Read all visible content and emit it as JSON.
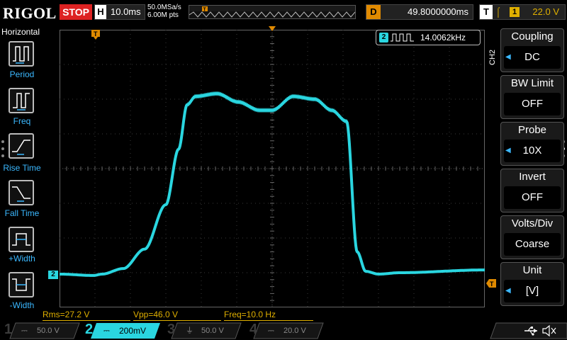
{
  "header": {
    "brand": "RIGOL",
    "run_state": "STOP",
    "timebase_label": "H",
    "timebase_value": "10.0ms",
    "sample_rate": "50.0MSa/s",
    "memory_depth": "6.00M pts",
    "trigger_position_label": "D",
    "trigger_position_value": "49.8000000ms",
    "trigger_type_label": "T",
    "trigger_source": "1",
    "trigger_level": "22.0 V"
  },
  "left_menu": {
    "title": "Horizontal",
    "items": [
      {
        "label": "Period",
        "icon": "period-icon"
      },
      {
        "label": "Freq",
        "icon": "freq-icon"
      },
      {
        "label": "Rise Time",
        "icon": "rise-time-icon"
      },
      {
        "label": "Fall Time",
        "icon": "fall-time-icon"
      },
      {
        "label": "+Width",
        "icon": "pos-width-icon"
      },
      {
        "label": "-Width",
        "icon": "neg-width-icon"
      }
    ]
  },
  "freq_counter": {
    "channel": "2",
    "value": "14.0062kHz"
  },
  "right_menu": {
    "channel_tag": "CH2",
    "items": [
      {
        "title": "Coupling",
        "value": "DC"
      },
      {
        "title": "BW Limit",
        "value": "OFF"
      },
      {
        "title": "Probe",
        "value": "10X"
      },
      {
        "title": "Invert",
        "value": "OFF"
      },
      {
        "title": "Volts/Div",
        "value": "Coarse"
      },
      {
        "title": "Unit",
        "value": "[V]"
      }
    ]
  },
  "measurements": [
    {
      "text": "Rms=27.2 V"
    },
    {
      "text": "Vpp=46.0 V"
    },
    {
      "text": "Freq=10.0 Hz"
    }
  ],
  "channels": [
    {
      "num": "1",
      "value": "50.0 V",
      "active": false,
      "color": "#e8d800"
    },
    {
      "num": "2",
      "value": "200mV",
      "active": true,
      "color": "#00e5ee"
    },
    {
      "num": "3",
      "value": "50.0 V",
      "active": false,
      "color": "#d040d0"
    },
    {
      "num": "4",
      "value": "20.0 V",
      "active": false,
      "color": "#2a5cff"
    }
  ],
  "ch2_marker": "2",
  "colors": {
    "trace": "#2ad6e0",
    "grid": "#3a3a3a",
    "trigger": "#e08a00",
    "accent_blue": "#3bb8ff"
  },
  "trace_shape": [
    [
      0.0,
      0.88
    ],
    [
      0.08,
      0.885
    ],
    [
      0.1,
      0.88
    ],
    [
      0.15,
      0.86
    ],
    [
      0.2,
      0.79
    ],
    [
      0.25,
      0.63
    ],
    [
      0.28,
      0.43
    ],
    [
      0.3,
      0.27
    ],
    [
      0.32,
      0.24
    ],
    [
      0.37,
      0.23
    ],
    [
      0.42,
      0.26
    ],
    [
      0.47,
      0.29
    ],
    [
      0.5,
      0.29
    ],
    [
      0.55,
      0.24
    ],
    [
      0.6,
      0.25
    ],
    [
      0.64,
      0.29
    ],
    [
      0.675,
      0.33
    ],
    [
      0.7,
      0.8
    ],
    [
      0.72,
      0.87
    ],
    [
      0.75,
      0.88
    ],
    [
      0.8,
      0.875
    ],
    [
      1.0,
      0.865
    ]
  ]
}
